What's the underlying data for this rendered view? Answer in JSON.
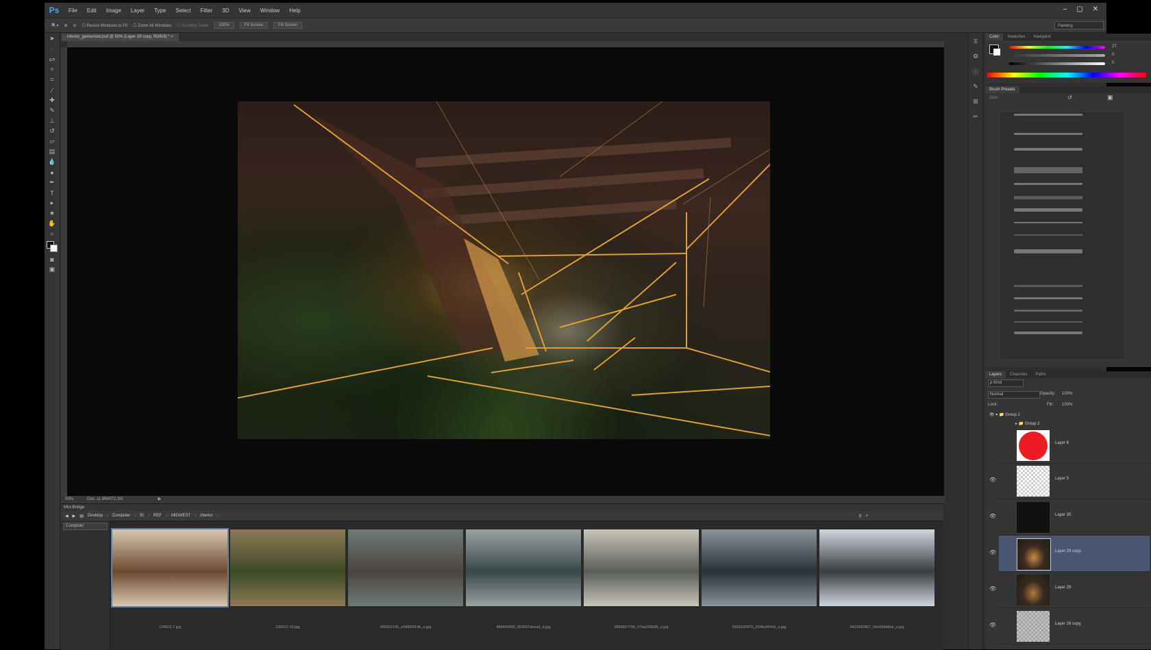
{
  "app": {
    "logo": "Ps"
  },
  "menu": [
    "File",
    "Edit",
    "Image",
    "Layer",
    "Type",
    "Select",
    "Filter",
    "3D",
    "View",
    "Window",
    "Help"
  ],
  "window_controls": [
    "–",
    "▢",
    "✕"
  ],
  "options_bar": {
    "resize": "Resize Windows to Fit",
    "zoom_all": "Zoom All Windows",
    "scrubby": "Scrubby Zoom",
    "pct100": "100%",
    "fit_screen": "Fit Screen",
    "fill_screen": "Fill Screen",
    "workspace": "Painting"
  },
  "document": {
    "tab": "interior_gamerood.psd @ 50% (Layer 29 copy, RGB/8) *"
  },
  "status": {
    "zoom": "50%",
    "doc": "Doc: 11.9M/472.1M"
  },
  "bridge": {
    "title": "Mini Bridge",
    "breadcrumb": [
      "Desktop",
      "Computer",
      "EI",
      "REF",
      "MIDWEST",
      "interior"
    ],
    "location": "Computer",
    "thumbnails": [
      {
        "label": "134522-7.jpg",
        "colors": [
          "#6b4a30",
          "#d8c8b0"
        ]
      },
      {
        "label": "134522-19.jpg",
        "colors": [
          "#3e4a25",
          "#8c7a55"
        ]
      },
      {
        "label": "482822165_e5685f414b_o.jpg",
        "colors": [
          "#4a4540",
          "#6f7a78"
        ]
      },
      {
        "label": "488449992_853037deea3_b.jpg",
        "colors": [
          "#3a4748",
          "#9aa2a2"
        ]
      },
      {
        "label": "2884697799_37da229b98_o.jpg",
        "colors": [
          "#5a5e5a",
          "#c8c4b8"
        ]
      },
      {
        "label": "3329192879_2346e993cb_o.jpg",
        "colors": [
          "#2a3138",
          "#8a939a"
        ]
      },
      {
        "label": "3423642867_50e08dd8ee_o.jpg",
        "colors": [
          "#3a3d42",
          "#cfd6dc"
        ]
      }
    ]
  },
  "color_panel": {
    "tabs": [
      "Color",
      "Swatches",
      "Navigator"
    ],
    "value_r": "27",
    "value_g": "0",
    "value_b": "0"
  },
  "brush_panel": {
    "title": "Brush Presets",
    "size_label": "Size:"
  },
  "layers_panel": {
    "tabs": [
      "Layers",
      "Channels",
      "Paths"
    ],
    "kind": "ρ Kind",
    "blend_mode": "Normal",
    "opacity_label": "Opacity:",
    "opacity": "100%",
    "lock_label": "Lock:",
    "fill_label": "Fill:",
    "fill": "100%",
    "groups": [
      {
        "name": "Group 1"
      },
      {
        "name": "Group 2"
      }
    ],
    "layers": [
      {
        "name": "Layer 6",
        "thumb": "red"
      },
      {
        "name": "Layer 5",
        "thumb": "checker"
      },
      {
        "name": "Layer 30",
        "thumb": "dark"
      },
      {
        "name": "Layer 29 copy",
        "thumb": "art"
      },
      {
        "name": "Layer 29",
        "thumb": "art"
      },
      {
        "name": "Layer 26 copy",
        "thumb": "checker"
      }
    ]
  },
  "colors": {
    "accent_line": "#e0a030",
    "selection": "#4b5670",
    "ps_blue": "#4fa3f7"
  }
}
